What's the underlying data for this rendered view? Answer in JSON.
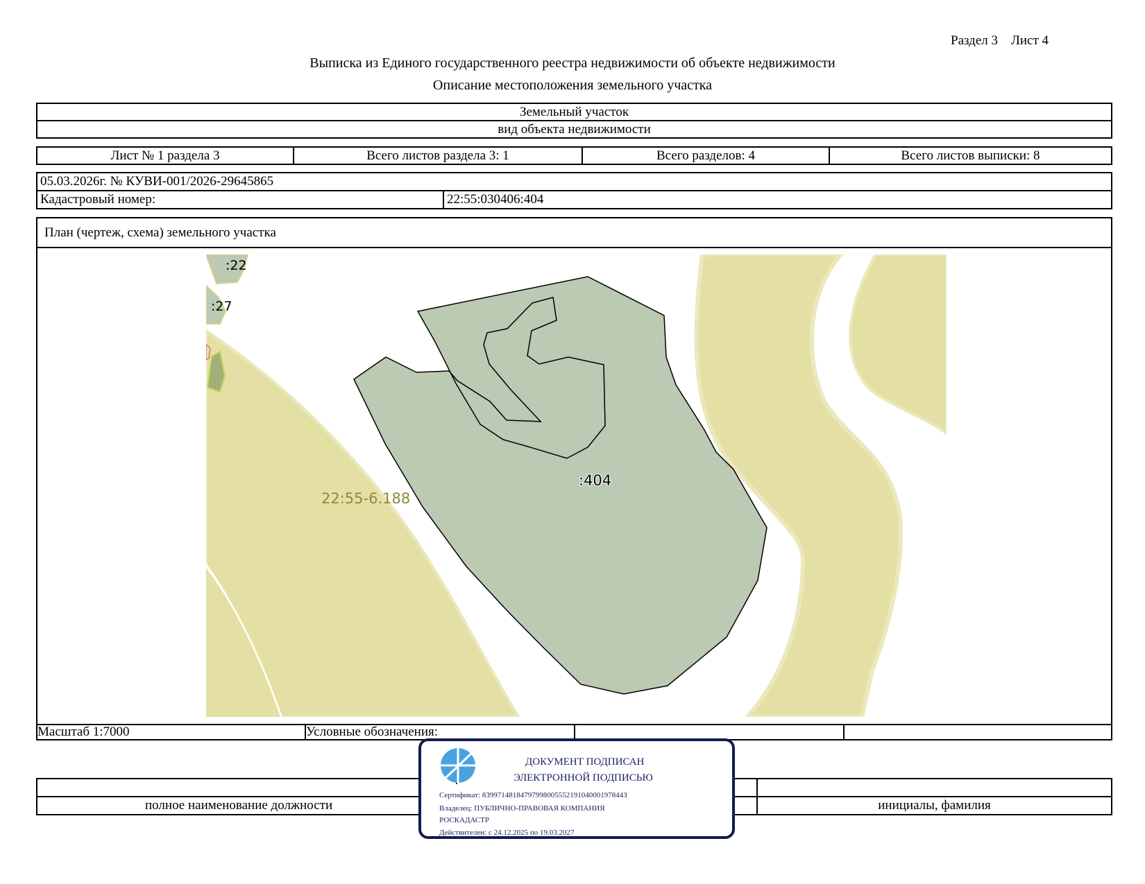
{
  "header": {
    "section": "Раздел 3",
    "sheet": "Лист 4",
    "title": "Выписка из Единого государственного реестра недвижимости об объекте недвижимости",
    "subtitle": "Описание местоположения земельного участка"
  },
  "object": {
    "type_value": "Земельный участок",
    "type_caption": "вид объекта недвижимости"
  },
  "sheets": {
    "sheet_no": "Лист № 1 раздела 3",
    "section_sheets": "Всего листов раздела 3: 1",
    "sections_total": "Всего разделов: 4",
    "extract_sheets": "Всего листов выписки: 8"
  },
  "record": {
    "date_number": "05.03.2026г. № КУВИ-001/2026-29645865",
    "cadastral_label": "Кадастровый номер:",
    "cadastral_value": "22:55:030406:404"
  },
  "plan": {
    "title": "План (чертеж, схема) земельного участка",
    "labels": {
      "main": ":404",
      "zone": "22:55-6.188",
      "parcel_22": ":22",
      "parcel_27": ":27"
    },
    "colors": {
      "parcel_fill": "#bcc9b3",
      "zone_fill": "#e4e0a5",
      "zone_edge": "#ebe8bd",
      "zone_label": "#8c8a3a"
    }
  },
  "scale": {
    "label": "Масштаб 1:7000",
    "legend_label": "Условные обозначения:"
  },
  "signature": {
    "position_caption": "полное наименование должности",
    "name_caption": "инициалы, фамилия"
  },
  "stamp": {
    "line1": "ДОКУМЕНТ ПОДПИСАН",
    "line2": "ЭЛЕКТРОННОЙ ПОДПИСЬЮ",
    "certificate": "Сертификат: 8399714818479799800555219104000197844З",
    "owner_1": "Владелец: ПУБЛИЧНО-ПРАВОВАЯ КОМПАНИЯ",
    "owner_2": "РОСКАДАСТР",
    "valid": "Действителен: с 24.12.2025 по 19.03.2027",
    "logo_icon": "rosreestr-logo-icon",
    "color": "#131a4e"
  }
}
